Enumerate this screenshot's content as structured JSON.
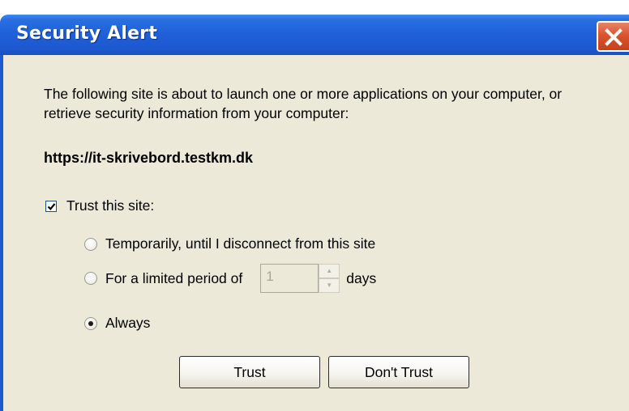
{
  "dialog": {
    "title": "Security Alert",
    "close_icon": "close-icon",
    "message": "The following site is about to launch one or more applications on your computer, or retrieve security information from your computer:",
    "site_url": "https://it-skrivebord.testkm.dk",
    "trust_checkbox": {
      "label": "Trust this site:",
      "checked": true
    },
    "options": {
      "temporarily": {
        "label": "Temporarily, until I disconnect from this site",
        "selected": false
      },
      "limited_period": {
        "label": "For a limited period of",
        "selected": false,
        "days_value": "1",
        "days_unit": "days"
      },
      "always": {
        "label": "Always",
        "selected": true
      }
    },
    "buttons": {
      "trust": "Trust",
      "dont_trust": "Don't Trust"
    }
  },
  "colors": {
    "titlebar": "#1f5fd8",
    "close_button": "#d9542f",
    "dialog_background": "#ece9d8"
  }
}
